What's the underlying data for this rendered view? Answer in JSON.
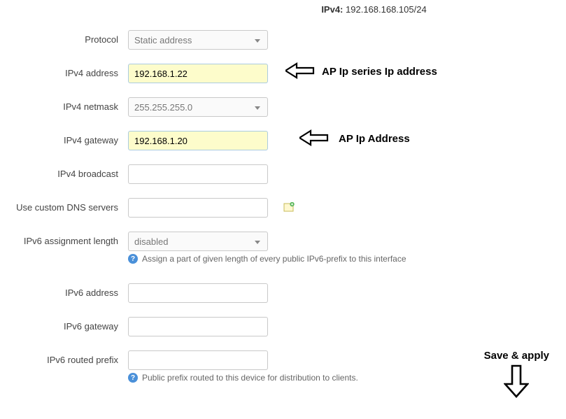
{
  "header": {
    "label": "IPv4:",
    "value": "192.168.168.105/24"
  },
  "fields": {
    "protocol": {
      "label": "Protocol",
      "value": "Static address"
    },
    "ipv4_address": {
      "label": "IPv4 address",
      "value": "192.168.1.22"
    },
    "ipv4_netmask": {
      "label": "IPv4 netmask",
      "value": "255.255.255.0"
    },
    "ipv4_gateway": {
      "label": "IPv4 gateway",
      "value": "192.168.1.20"
    },
    "ipv4_broadcast": {
      "label": "IPv4 broadcast",
      "value": ""
    },
    "custom_dns": {
      "label": "Use custom DNS servers",
      "value": ""
    },
    "ipv6_assign_len": {
      "label": "IPv6 assignment length",
      "value": "disabled",
      "hint": "Assign a part of given length of every public IPv6-prefix to this interface"
    },
    "ipv6_address": {
      "label": "IPv6 address",
      "value": ""
    },
    "ipv6_gateway": {
      "label": "IPv6 gateway",
      "value": ""
    },
    "ipv6_routed_prefix": {
      "label": "IPv6 routed prefix",
      "value": "",
      "hint": "Public prefix routed to this device for distribution to clients."
    }
  },
  "annotations": {
    "ap_series": "AP Ip series Ip address",
    "ap_addr": "AP  Ip Address",
    "save_apply": "Save & apply"
  }
}
